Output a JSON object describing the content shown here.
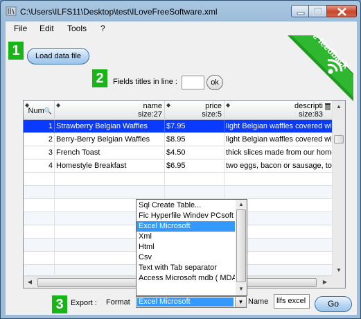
{
  "window": {
    "title": "C:\\Users\\ILFS11\\Desktop\\test\\ILoveFreeSoftware.xml"
  },
  "menu": [
    "File",
    "Edit",
    "Tools",
    "?"
  ],
  "steps": {
    "one": "1",
    "two": "2",
    "three": "3"
  },
  "load_button": "Load data file",
  "fields_titles": {
    "label": "Fields titles in line :",
    "value": "",
    "ok_label": "ok"
  },
  "feedback": {
    "text": "Give feedback",
    "icon": "rss-icon"
  },
  "grid": {
    "columns": [
      {
        "name": "Num",
        "size": ""
      },
      {
        "name": "name",
        "size": "size:27"
      },
      {
        "name": "price",
        "size": "size:5"
      },
      {
        "name": "descripti",
        "size": "size:83"
      }
    ],
    "rows": [
      {
        "num": "1",
        "name": "Strawberry Belgian Waffles",
        "price": "$7.95",
        "description": "light Belgian waffles covered wit"
      },
      {
        "num": "2",
        "name": "Berry-Berry Belgian Waffles",
        "price": "$8.95",
        "description": "light Belgian waffles covered wit"
      },
      {
        "num": "3",
        "name": "French Toast",
        "price": "$4.50",
        "description": "thick slices made from our home"
      },
      {
        "num": "4",
        "name": "Homestyle Breakfast",
        "price": "$6.95",
        "description": "two eggs, bacon or sausage, toa"
      }
    ],
    "selected_row": 0
  },
  "format_options": [
    "Sql Create Table...",
    "Fic Hyperfile Windev PCsoft",
    "Excel Microsoft",
    "Xml",
    "Html",
    "Csv",
    "Text with Tab separator",
    "Access Microsoft mdb ( MDA"
  ],
  "export": {
    "label": "Export :",
    "format_label": "Format",
    "format_value": "Excel Microsoft",
    "name_label": "Name",
    "name_value": "llfs excel",
    "go_label": "Go"
  },
  "colors": {
    "step_green": "#18b418",
    "selection": "#0a39ff",
    "list_selection": "#3399ff"
  }
}
